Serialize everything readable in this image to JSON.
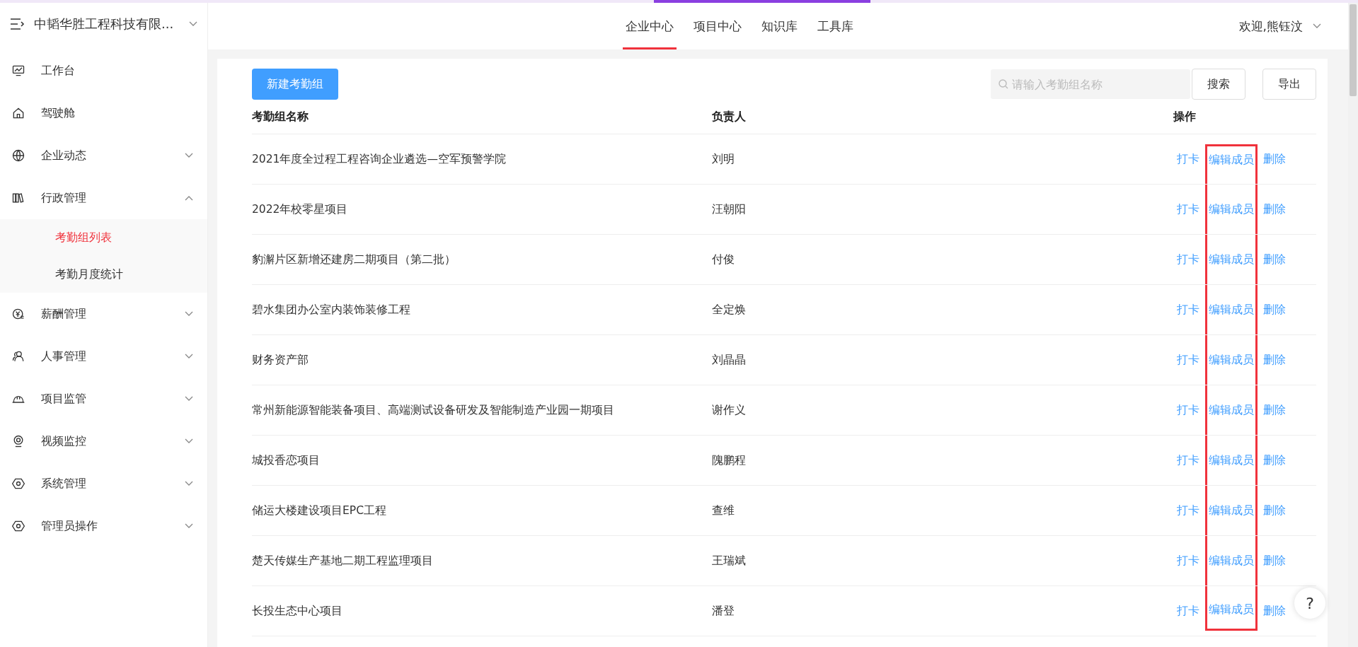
{
  "sidebar": {
    "company": "中韬华胜工程科技有限...",
    "items": [
      {
        "label": "工作台"
      },
      {
        "label": "驾驶舱"
      },
      {
        "label": "企业动态",
        "expanded": false
      },
      {
        "label": "行政管理",
        "expanded": true,
        "children": [
          {
            "label": "考勤组列表",
            "selected": true
          },
          {
            "label": "考勤月度统计",
            "selected": false
          }
        ]
      },
      {
        "label": "薪酬管理",
        "expanded": false
      },
      {
        "label": "人事管理",
        "expanded": false
      },
      {
        "label": "项目监管",
        "expanded": false
      },
      {
        "label": "视频监控",
        "expanded": false
      },
      {
        "label": "系统管理",
        "expanded": false
      },
      {
        "label": "管理员操作",
        "expanded": false
      }
    ]
  },
  "top_nav": {
    "tabs": [
      {
        "label": "企业中心",
        "selected": true
      },
      {
        "label": "项目中心",
        "selected": false
      },
      {
        "label": "知识库",
        "selected": false
      },
      {
        "label": "工具库",
        "selected": false
      }
    ],
    "user": "欢迎,熊钰汶"
  },
  "toolbar": {
    "new_button": "新建考勤组",
    "search": {
      "placeholder": "请输入考勤组名称"
    },
    "buttons": [
      "搜索",
      "导出"
    ]
  },
  "table": {
    "columns": [
      "考勤组名称",
      "负责人",
      "操作"
    ],
    "rows": [
      {
        "name": "2021年度全过程工程咨询企业遴选—空军预警学院",
        "owner": "刘明",
        "actions": [
          {
            "label": "打卡",
            "highlighted": false
          },
          {
            "label": "编辑成员",
            "highlighted": true
          },
          {
            "label": "删除",
            "highlighted": false
          }
        ]
      },
      {
        "name": "2022年校零星项目",
        "owner": "汪朝阳",
        "actions": [
          {
            "label": "打卡",
            "highlighted": false
          },
          {
            "label": "编辑成员",
            "highlighted": true
          },
          {
            "label": "删除",
            "highlighted": false
          }
        ]
      },
      {
        "name": "豹澥片区新增还建房二期项目（第二批）",
        "owner": "付俊",
        "actions": [
          {
            "label": "打卡",
            "highlighted": false
          },
          {
            "label": "编辑成员",
            "highlighted": true
          },
          {
            "label": "删除",
            "highlighted": false
          }
        ]
      },
      {
        "name": "碧水集团办公室内装饰装修工程",
        "owner": "全定焕",
        "actions": [
          {
            "label": "打卡",
            "highlighted": false
          },
          {
            "label": "编辑成员",
            "highlighted": true
          },
          {
            "label": "删除",
            "highlighted": false
          }
        ]
      },
      {
        "name": "财务资产部",
        "owner": "刘晶晶",
        "actions": [
          {
            "label": "打卡",
            "highlighted": false
          },
          {
            "label": "编辑成员",
            "highlighted": true
          },
          {
            "label": "删除",
            "highlighted": false
          }
        ]
      },
      {
        "name": "常州新能源智能装备项目、高端测试设备研发及智能制造产业园一期项目",
        "owner": "谢作义",
        "actions": [
          {
            "label": "打卡",
            "highlighted": false
          },
          {
            "label": "编辑成员",
            "highlighted": true
          },
          {
            "label": "删除",
            "highlighted": false
          }
        ]
      },
      {
        "name": "城投香恋项目",
        "owner": "隗鹏程",
        "actions": [
          {
            "label": "打卡",
            "highlighted": false
          },
          {
            "label": "编辑成员",
            "highlighted": true
          },
          {
            "label": "删除",
            "highlighted": false
          }
        ]
      },
      {
        "name": "储运大楼建设项目EPC工程",
        "owner": "查维",
        "actions": [
          {
            "label": "打卡",
            "highlighted": false
          },
          {
            "label": "编辑成员",
            "highlighted": true
          },
          {
            "label": "删除",
            "highlighted": false
          }
        ]
      },
      {
        "name": "楚天传媒生产基地二期工程监理项目",
        "owner": "王瑞斌",
        "actions": [
          {
            "label": "打卡",
            "highlighted": false
          },
          {
            "label": "编辑成员",
            "highlighted": true
          },
          {
            "label": "删除",
            "highlighted": false
          }
        ]
      },
      {
        "name": "长投生态中心项目",
        "owner": "潘登",
        "actions": [
          {
            "label": "打卡",
            "highlighted": false
          },
          {
            "label": "编辑成员",
            "highlighted": true
          },
          {
            "label": "删除",
            "highlighted": false
          }
        ]
      }
    ]
  },
  "help_button": "?"
}
